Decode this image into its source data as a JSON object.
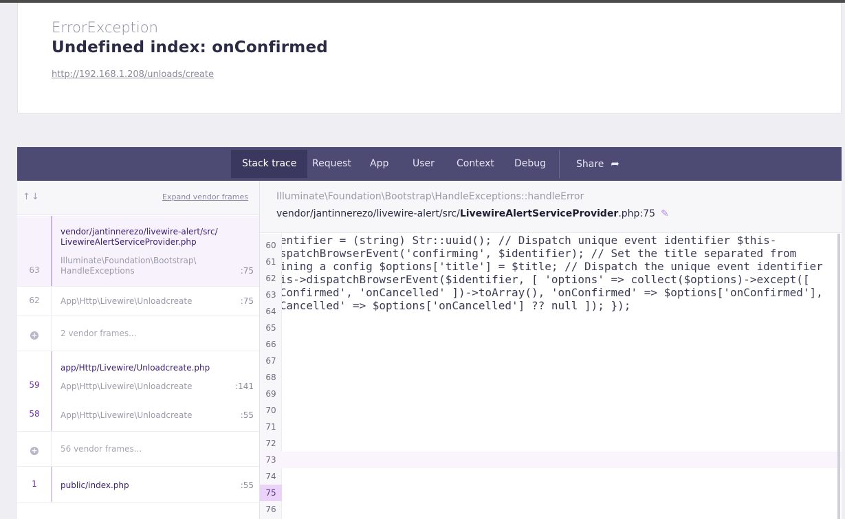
{
  "header": {
    "exception_class": "ErrorException",
    "message": "Undefined index: onConfirmed",
    "url": "http://192.168.1.208/unloads/create"
  },
  "tabs": [
    {
      "label": "Stack trace",
      "active": true
    },
    {
      "label": "Request"
    },
    {
      "label": "App"
    },
    {
      "label": "User"
    },
    {
      "label": "Context"
    },
    {
      "label": "Debug"
    },
    {
      "label": "Share"
    }
  ],
  "share_icon": "share-arrow-icon",
  "left_panel": {
    "expand_label": "Expand vendor frames",
    "groups": [
      {
        "file": "vendor/jantinnerezo/livewire-alert/src/\nLivewireAlertServiceProvider.php",
        "frames": [
          {
            "number": "63",
            "function": "Illuminate\\Foundation\\Bootstrap\\\nHandleExceptions",
            "line": ":75"
          }
        ]
      },
      {
        "frames": [
          {
            "number": "62",
            "function": "App\\Http\\Livewire\\Unloadcreate",
            "line": ":75"
          }
        ]
      },
      {
        "vendor_frames": "2 vendor frames..."
      },
      {
        "file": "app/Http/Livewire/Unloadcreate.php",
        "frames": [
          {
            "number": "59",
            "function": "App\\Http\\Livewire\\Unloadcreate",
            "line": ":141"
          },
          {
            "number": "58",
            "function": "App\\Http\\Livewire\\Unloadcreate",
            "line": ":55"
          }
        ]
      },
      {
        "vendor_frames": "56 vendor frames..."
      },
      {
        "file": "public/index.php",
        "frames": [
          {
            "number": "1",
            "line": ":55"
          }
        ]
      }
    ]
  },
  "right_panel": {
    "class_prefix": "Illuminate\\Foundation\\Bootstrap\\",
    "class_name": "HandleExceptions",
    "method": "::handleError",
    "file_prefix": "vendor/jantinnerezo/livewire-alert/src/",
    "file_name": "LivewireAlertServiceProvider",
    "file_suffix": ".php:75",
    "edit_icon": "pencil-icon",
    "code_lines": [
      {
        "n": "60",
        "text": ""
      },
      {
        "n": "61",
        "text": "            $identifier = (string) Str::uuid();"
      },
      {
        "n": "62",
        "text": "            // Dispatch unique event identifier"
      },
      {
        "n": "63",
        "text": "            $this->dispatchBrowserEvent('confirming', $identifier);"
      },
      {
        "n": "64",
        "text": ""
      },
      {
        "n": "65",
        "text": "            // Set the title separated from defining a config"
      },
      {
        "n": "",
        "text": "            $options['title'] = $title;"
      },
      {
        "n": "66",
        "text": ""
      },
      {
        "n": "67",
        "text": "            // Dispatch the unique event identifier"
      },
      {
        "n": "68",
        "text": "            $this->dispatchBrowserEvent($identifier, ["
      },
      {
        "n": "69",
        "text": "                'options' => collect($options)->except(["
      },
      {
        "n": "70",
        "text": "                    'onConfirmed',"
      },
      {
        "n": "71",
        "text": "                    'onCancelled'"
      },
      {
        "n": "72",
        "text": "                ])->toArray(),"
      },
      {
        "n": "73",
        "text": "                'onConfirmed' => $options['onConfirmed'],"
      },
      {
        "n": "74",
        "text": "                'onCancelled' => $options['onCancelled'] ?? null"
      },
      {
        "n": "75",
        "text": "            ]);"
      },
      {
        "n": "76",
        "text": "        });"
      }
    ]
  },
  "colors": {
    "tabbar": "#4d4a73",
    "active_tab": "#3b3860",
    "selected_frame": "#f8f2fd",
    "highlight_line": "#ead2f8"
  }
}
